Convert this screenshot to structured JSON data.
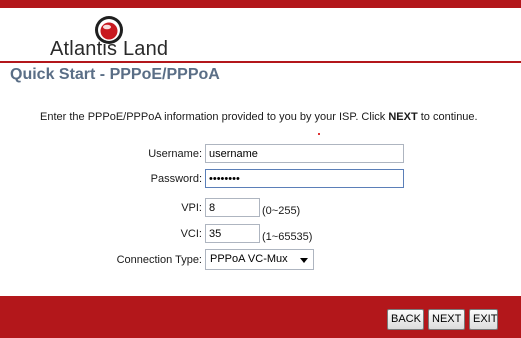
{
  "brand": {
    "name": "Atlantis Land"
  },
  "page": {
    "title": "Quick Start - PPPoE/PPPoA"
  },
  "instruction": {
    "prefix": "Enter the PPPoE/PPPoA information provided to you by your ISP. Click ",
    "emphasis": "NEXT",
    "suffix": " to continue."
  },
  "form": {
    "username": {
      "label": "Username:",
      "value": "username"
    },
    "password": {
      "label": "Password:",
      "value": "••••••••"
    },
    "vpi": {
      "label": "VPI:",
      "value": "8",
      "range": "(0~255)"
    },
    "vci": {
      "label": "VCI:",
      "value": "35",
      "range": "(1~65535)"
    },
    "connection_type": {
      "label": "Connection Type:",
      "selected": "PPPoA VC-Mux"
    }
  },
  "buttons": {
    "back": "BACK",
    "next": "NEXT",
    "exit": "EXIT"
  },
  "colors": {
    "brand_red": "#b3171b",
    "title_blue": "#5a6e86"
  }
}
